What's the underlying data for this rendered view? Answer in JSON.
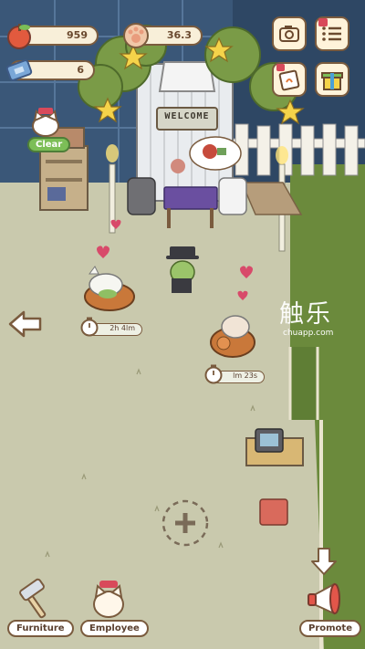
{
  "hud": {
    "apples_value": "959",
    "paws_value": "36.3",
    "tickets_value": "6"
  },
  "bed_timers": [
    {
      "label": "2h 4lm"
    },
    {
      "label": "lm 23s"
    }
  ],
  "sign": {
    "text": "WELCOME"
  },
  "badge": {
    "clear_label": "Clear"
  },
  "bottom_bar": {
    "furniture_label": "Furniture",
    "employee_label": "Employee",
    "promote_label": "Promote"
  },
  "watermark": {
    "title": "触乐",
    "url": "chuapp.com"
  },
  "colors": {
    "floor": "#c9c9ad",
    "wall_night": "#2f4a66",
    "lawn": "#6b8a3c",
    "outline": "#7a5b3e",
    "pill_bg": "#f8efd9"
  },
  "icons": [
    "apple-icon",
    "paw-cookie-icon",
    "ticket-icon",
    "camera-icon",
    "menu-list-icon",
    "gift-icon",
    "note-icon",
    "back-arrow-icon",
    "add-plus-icon",
    "hammer-icon",
    "cat-employee-icon",
    "megaphone-icon",
    "down-arrow-icon"
  ]
}
